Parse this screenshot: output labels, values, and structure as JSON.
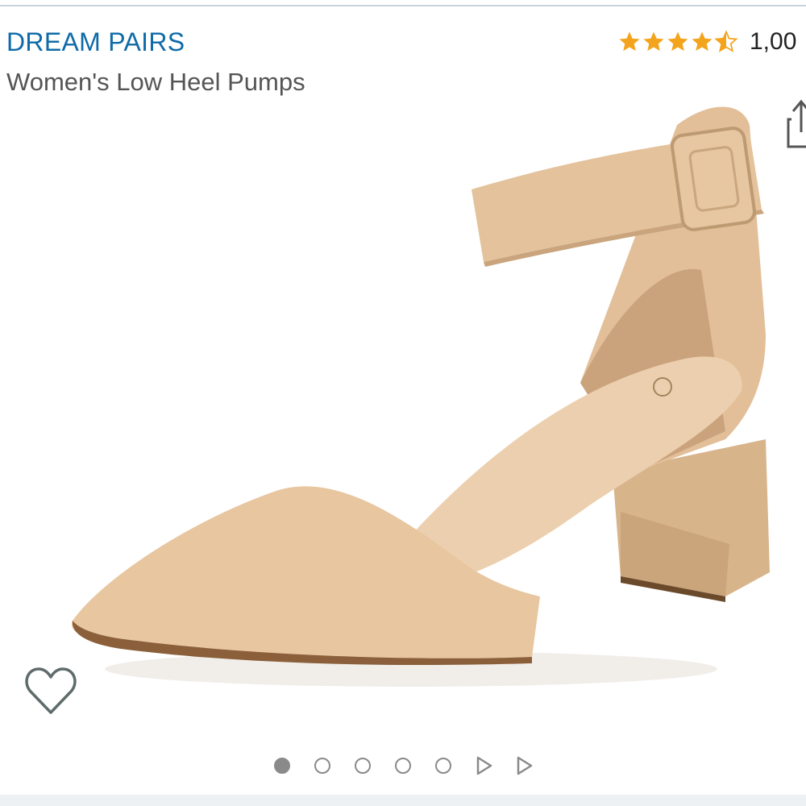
{
  "product": {
    "brand": "DREAM PAIRS",
    "title": "Women's Low Heel Pumps",
    "rating_value": 4.5,
    "rating_count_text": "1,00",
    "image_alt": "Women's Low Heel Pumps"
  },
  "carousel": {
    "total_dots": 5,
    "active_index": 0,
    "video_thumbnails": 2
  },
  "colors": {
    "brand_link": "#0f6ba8",
    "star": "#f4a41c",
    "shoe": "#e7c6a0",
    "indicator": "#8a8a8a"
  },
  "icons": {
    "wishlist": "heart-outline-icon",
    "share": "share-icon",
    "video": "play-triangle-icon"
  }
}
